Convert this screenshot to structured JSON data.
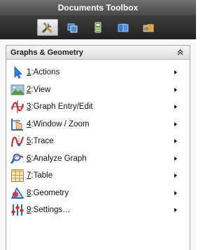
{
  "window": {
    "title": "Documents Toolbox"
  },
  "tool_tabs": [
    {
      "name": "tools-icon",
      "active": true
    },
    {
      "name": "page-sorter-icon",
      "active": false
    },
    {
      "name": "calculator-icon",
      "active": false
    },
    {
      "name": "library-icon",
      "active": false
    },
    {
      "name": "content-explorer-icon",
      "active": false
    }
  ],
  "panel": {
    "title": "Graphs & Geometry",
    "collapse_glyph": "ˆ"
  },
  "menu": [
    {
      "num": "1",
      "text": ":Actions",
      "icon": "arrow-pointer-icon"
    },
    {
      "num": "2",
      "text": ":View",
      "icon": "view-icon"
    },
    {
      "num": "3",
      "text": ":Graph Entry/Edit",
      "icon": "graph-entry-icon"
    },
    {
      "num": "4",
      "text": ":Window / Zoom",
      "icon": "zoom-icon"
    },
    {
      "num": "5",
      "text": ":Trace",
      "icon": "trace-icon"
    },
    {
      "num": "6",
      "text": ":Analyze Graph",
      "icon": "analyze-graph-icon"
    },
    {
      "num": "7",
      "text": ":Table",
      "icon": "table-icon"
    },
    {
      "num": "8",
      "text": ":Geometry",
      "icon": "geometry-icon"
    },
    {
      "num": "9",
      "text": ":Settings…",
      "icon": "settings-icon"
    }
  ]
}
